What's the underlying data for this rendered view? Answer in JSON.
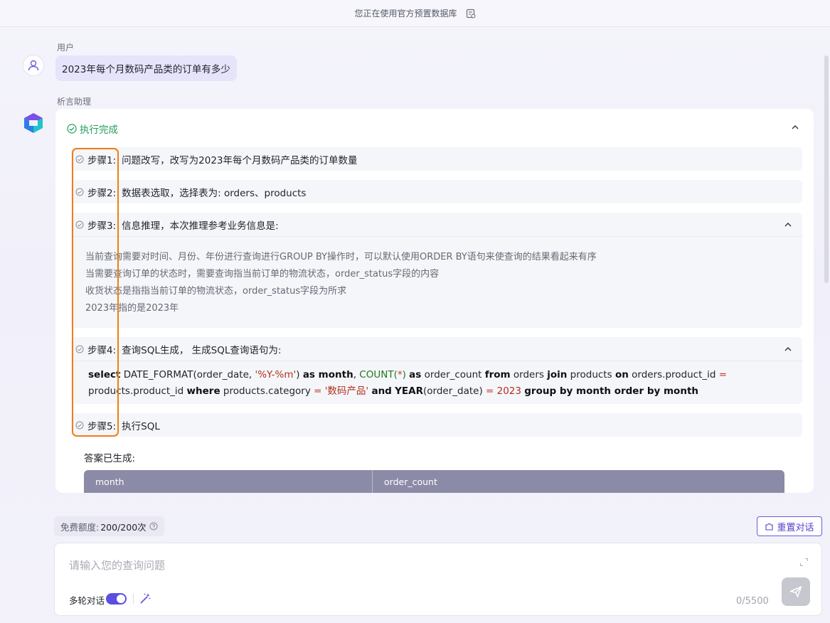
{
  "topbar": {
    "notice": "您正在使用官方预置数据库",
    "db_icon": "database-switch-icon"
  },
  "user": {
    "role_label": "用户",
    "question": "2023年每个月数码产品类的订单有多少"
  },
  "assistant": {
    "role_label": "析言助理",
    "status": "执行完成",
    "steps": [
      {
        "no": "步骤1:",
        "title": "问题改写，改写为2023年每个月数码产品类的订单数量"
      },
      {
        "no": "步骤2:",
        "title": "数据表选取，选择表为: orders、products"
      },
      {
        "no": "步骤3:",
        "title": "信息推理，本次推理参考业务信息是:",
        "lines": [
          "当前查询需要对时间、月份、年份进行查询进行GROUP BY操作时，可以默认使用ORDER BY语句来使查询的结果看起来有序",
          "当需要查询订单的状态时，需要查询指当前订单的物流状态，order_status字段的内容",
          "收货状态是指指当前订单的物流状态，order_status字段为所求",
          "2023年指的是2023年"
        ]
      },
      {
        "no": "步骤4:",
        "title": "查询SQL生成， 生成SQL查询语句为:",
        "sql": {
          "t1": "select",
          "t2": " DATE_FORMAT(order_date, ",
          "t3": "'%Y-%m'",
          "t4": ") ",
          "t5": "as month",
          "t6": ", ",
          "t7": "COUNT",
          "t8": "(",
          "t9": "*",
          "t10": ")",
          "t11": " ",
          "t12": "as",
          "t13": " order_count ",
          "t14": "from",
          "t15": " orders ",
          "t16": "join",
          "t17": " products ",
          "t18": "on",
          "t19": " orders.product_id ",
          "t20": "=",
          "t21": "products.product_id ",
          "t22": "where",
          "t23": " products.category ",
          "t24": "=",
          "t25": " ",
          "t26": "'数码产品'",
          "t27": " ",
          "t28": "and",
          "t29": " ",
          "t30": "YEAR",
          "t31": "(order_date) ",
          "t32": "=",
          "t33": " ",
          "t34": "2023",
          "t35": " ",
          "t36": "group by month order by month"
        }
      },
      {
        "no": "步骤5:",
        "title": "执行SQL"
      }
    ],
    "answer_label": "答案已生成:",
    "table_headers": [
      "month",
      "order_count"
    ]
  },
  "footer": {
    "quota_label": "免费额度:",
    "quota_value": "200/200次",
    "reset_label": "重置对话",
    "input_placeholder": "请输入您的查询问题",
    "multi_turn_label": "多轮对话",
    "multi_turn_enabled": true,
    "char_count": "0/5500"
  },
  "colors": {
    "accent": "#5a4fe0",
    "success": "#1e9e5a",
    "highlight": "#f07d14",
    "table_header": "#8b8ba7"
  }
}
